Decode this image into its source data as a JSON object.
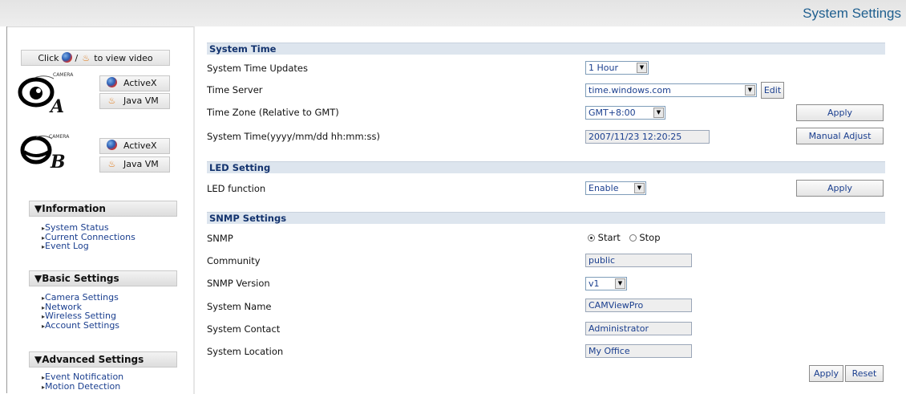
{
  "header": {
    "title": "System Settings"
  },
  "sidebar": {
    "click_prefix": "Click",
    "click_sep": "/",
    "click_suffix": "to view video",
    "cameras": [
      {
        "letter": "A",
        "brand": "CAMERA",
        "buttons": [
          "ActiveX",
          "Java VM"
        ]
      },
      {
        "letter": "B",
        "brand": "CAMERA",
        "buttons": [
          "ActiveX",
          "Java VM"
        ]
      }
    ],
    "sections": [
      {
        "title": "Information",
        "items": [
          "System Status",
          "Current Connections",
          "Event Log"
        ]
      },
      {
        "title": "Basic Settings",
        "items": [
          "Camera Settings",
          "Network",
          "Wireless Setting",
          "Account Settings"
        ]
      },
      {
        "title": "Advanced Settings",
        "items": [
          "Event Notification",
          "Motion Detection"
        ]
      }
    ]
  },
  "system_time": {
    "title": "System Time",
    "updates_label": "System Time Updates",
    "updates_value": "1 Hour",
    "server_label": "Time Server",
    "server_value": "time.windows.com",
    "edit_label": "Edit",
    "zone_label": "Time Zone (Relative to GMT)",
    "zone_value": "GMT+8:00",
    "apply_label": "Apply",
    "time_label": "System Time(yyyy/mm/dd hh:mm:ss)",
    "time_value": "2007/11/23 12:20:25",
    "manual_label": "Manual Adjust"
  },
  "led": {
    "title": "LED Setting",
    "function_label": "LED function",
    "function_value": "Enable",
    "apply_label": "Apply"
  },
  "snmp": {
    "title": "SNMP Settings",
    "snmp_label": "SNMP",
    "start_label": "Start",
    "stop_label": "Stop",
    "community_label": "Community",
    "community_value": "public",
    "version_label": "SNMP Version",
    "version_value": "v1",
    "name_label": "System Name",
    "name_value": "CAMViewPro",
    "contact_label": "System Contact",
    "contact_value": "Administrator",
    "location_label": "System Location",
    "location_value": "My Office",
    "apply_label": "Apply",
    "reset_label": "Reset"
  },
  "icons": {
    "dropdown": "chevron-down-icon",
    "nav_bullet": "triangle-right-icon",
    "section_toggle": "triangle-down-icon",
    "activex": "globe-icon",
    "java": "java-cup-icon",
    "camera": "eye-icon"
  },
  "colors": {
    "title_blue": "#1f5f8f",
    "section_bar": "#dde5ee",
    "link_blue": "#1b3f8f"
  }
}
